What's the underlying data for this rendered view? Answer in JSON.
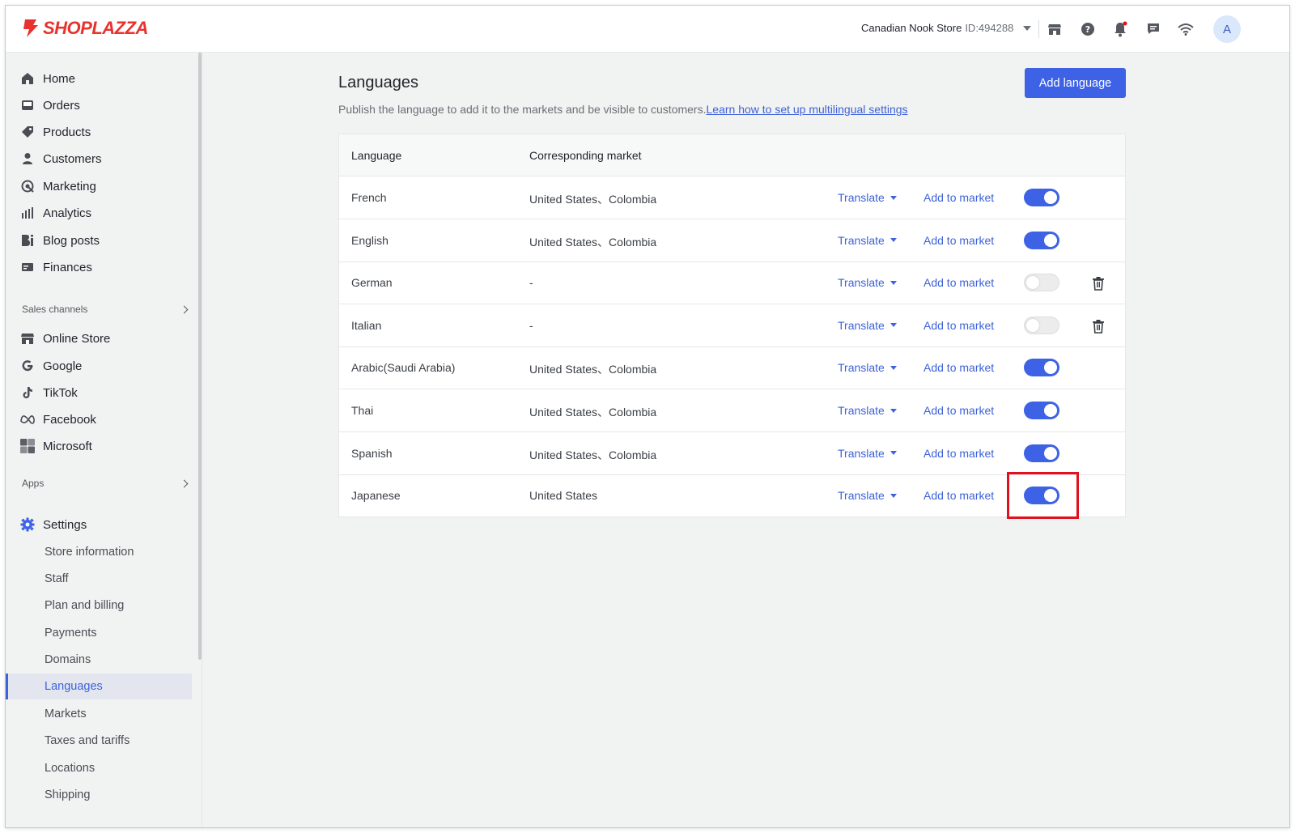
{
  "header": {
    "logo_text": "SHOPLAZZA",
    "store_name": "Canadian Nook Store",
    "store_id": "ID:494288",
    "icons": [
      "store-icon",
      "help-icon",
      "bell-icon",
      "chat-icon",
      "wifi-icon"
    ],
    "avatar_initial": "A"
  },
  "sidebar": {
    "main_items": [
      {
        "label": "Home",
        "icon": "home-icon"
      },
      {
        "label": "Orders",
        "icon": "orders-icon"
      },
      {
        "label": "Products",
        "icon": "tag-icon"
      },
      {
        "label": "Customers",
        "icon": "person-icon"
      },
      {
        "label": "Marketing",
        "icon": "marketing-icon"
      },
      {
        "label": "Analytics",
        "icon": "bar-chart-icon"
      },
      {
        "label": "Blog posts",
        "icon": "blog-icon"
      },
      {
        "label": "Finances",
        "icon": "finance-icon"
      }
    ],
    "sales_channels_label": "Sales channels",
    "channels": [
      {
        "label": "Online Store",
        "icon": "store-icon"
      },
      {
        "label": "Google",
        "icon": "google-icon"
      },
      {
        "label": "TikTok",
        "icon": "tiktok-icon"
      },
      {
        "label": "Facebook",
        "icon": "meta-icon"
      },
      {
        "label": "Microsoft",
        "icon": "microsoft-icon"
      }
    ],
    "apps_label": "Apps",
    "settings_label": "Settings",
    "settings_items": [
      "Store information",
      "Staff",
      "Plan and billing",
      "Payments",
      "Domains",
      "Languages",
      "Markets",
      "Taxes and tariffs",
      "Locations",
      "Shipping"
    ],
    "active_item": "Languages"
  },
  "main": {
    "title": "Languages",
    "description": "Publish the language to add it to the markets and be visible to customers.",
    "help_link": "Learn how to set up multilingual settings",
    "add_button": "Add language",
    "table": {
      "headers": [
        "Language",
        "Corresponding market"
      ],
      "translate_label": "Translate",
      "add_to_market_label": "Add to market",
      "rows": [
        {
          "language": "French",
          "market": "United States、Colombia",
          "published": true
        },
        {
          "language": "English",
          "market": "United States、Colombia",
          "published": true
        },
        {
          "language": "German",
          "market": "-",
          "published": false
        },
        {
          "language": "Italian",
          "market": "-",
          "published": false
        },
        {
          "language": "Arabic(Saudi Arabia)",
          "market": "United States、Colombia",
          "published": true
        },
        {
          "language": "Thai",
          "market": "United States、Colombia",
          "published": true
        },
        {
          "language": "Spanish",
          "market": "United States、Colombia",
          "published": true
        },
        {
          "language": "Japanese",
          "market": "United States",
          "published": true
        }
      ]
    }
  },
  "colors": {
    "accent": "#3d62e6",
    "link": "#3d62d9",
    "logo_red": "#e8322d",
    "highlight_box": "#e0121f"
  }
}
